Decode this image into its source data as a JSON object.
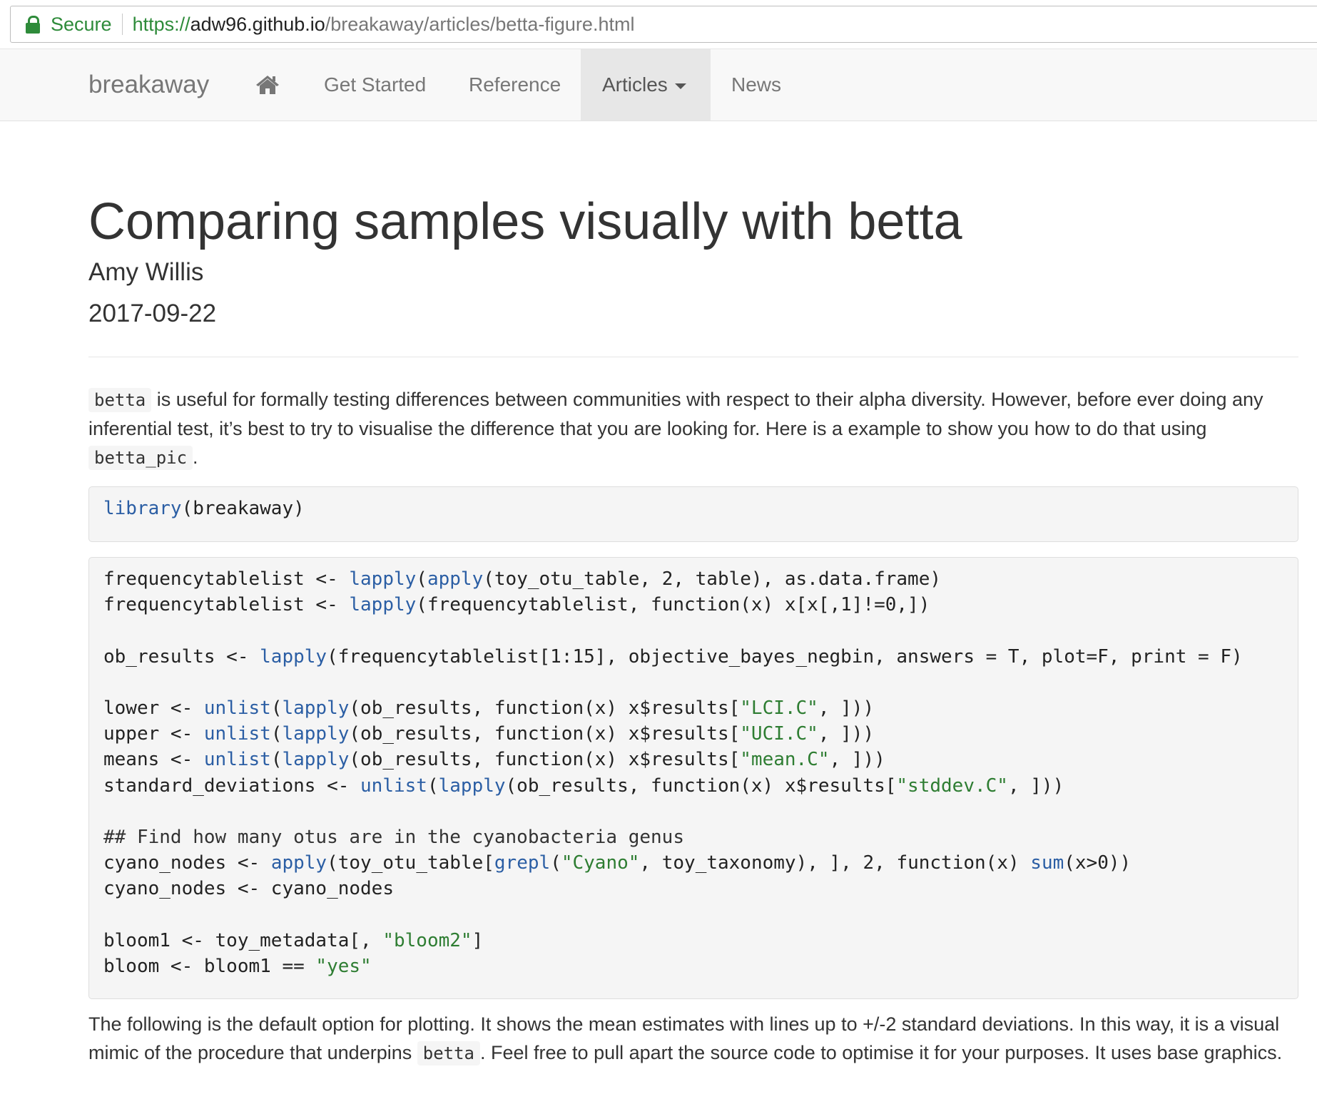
{
  "browser": {
    "secure_label": "Secure",
    "url_scheme": "https://",
    "url_host": "adw96.github.io",
    "url_path": "/breakaway/articles/betta-figure.html"
  },
  "navbar": {
    "brand": "breakaway",
    "home_icon": "home-icon",
    "items": [
      {
        "label": "Get Started"
      },
      {
        "label": "Reference"
      },
      {
        "label": "Articles",
        "active": true
      },
      {
        "label": "News"
      }
    ]
  },
  "article": {
    "title": "Comparing samples visually with betta",
    "author": "Amy Willis",
    "date": "2017-09-22",
    "intro": {
      "code1": "betta",
      "text1": " is useful for formally testing differences between communities with respect to their alpha diversity. However, before ever doing any inferential test, it’s best to try to visualise the difference that you are looking for. Here is a example to show you how to do that using ",
      "code2": "betta_pic",
      "text2": "."
    },
    "code_block_1": "library(breakaway)",
    "code_block_2": [
      "frequencytablelist <- lapply(apply(toy_otu_table, 2, table), as.data.frame)",
      "frequencytablelist <- lapply(frequencytablelist, function(x) x[x[,1]!=0,])",
      "",
      "ob_results <- lapply(frequencytablelist[1:15], objective_bayes_negbin, answers = T, plot=F, print = F)",
      "",
      "lower <- unlist(lapply(ob_results, function(x) x$results[\"LCI.C\", ]))",
      "upper <- unlist(lapply(ob_results, function(x) x$results[\"UCI.C\", ]))",
      "means <- unlist(lapply(ob_results, function(x) x$results[\"mean.C\", ]))",
      "standard_deviations <- unlist(lapply(ob_results, function(x) x$results[\"stddev.C\", ]))",
      "",
      "## Find how many otus are in the cyanobacteria genus",
      "cyano_nodes <- apply(toy_otu_table[grepl(\"Cyano\", toy_taxonomy), ], 2, function(x) sum(x>0))",
      "cyano_nodes <- cyano_nodes",
      "",
      "bloom1 <- toy_metadata[, \"bloom2\"]",
      "bloom <- bloom1 == \"yes\""
    ],
    "outro": {
      "text1": "The following is the default option for plotting. It shows the mean estimates with lines up to +/-2 standard deviations. In this way, it is a visual mimic of the procedure that underpins ",
      "code1": "betta",
      "text2": ". Feel free to pull apart the source code to optimise it for your purposes. It uses base graphics."
    }
  },
  "colors": {
    "secure_green": "#2e8b3a",
    "function_blue": "#2b5ea4",
    "string_green": "#2e7d32",
    "navbar_bg": "#f8f8f8",
    "code_bg": "#f5f5f5"
  }
}
